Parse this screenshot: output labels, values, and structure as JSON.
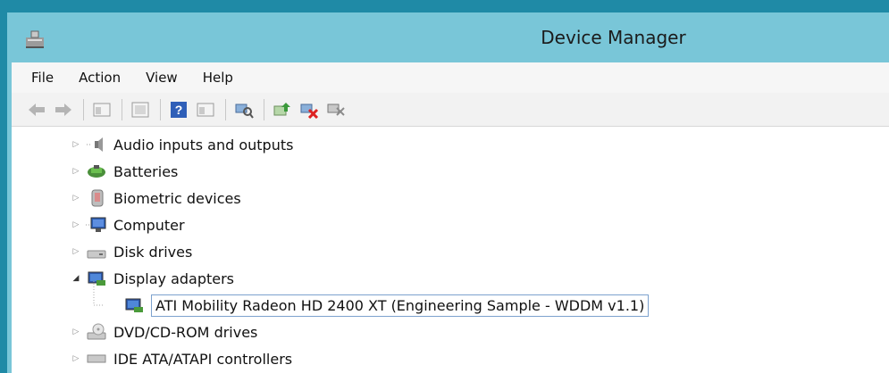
{
  "window": {
    "title": "Device Manager"
  },
  "menu": {
    "items": [
      "File",
      "Action",
      "View",
      "Help"
    ]
  },
  "toolbar": {
    "icons": [
      "back-icon",
      "forward-icon",
      "properties-view-icon",
      "hidden-devices-icon",
      "help-icon",
      "update-driver-view-icon",
      "scan-hardware-icon",
      "update-driver-icon",
      "uninstall-device-icon",
      "enable-device-icon"
    ]
  },
  "tree": {
    "items": [
      {
        "label": "Audio inputs and outputs",
        "icon": "speaker-icon",
        "expanded": false
      },
      {
        "label": "Batteries",
        "icon": "battery-icon",
        "expanded": false
      },
      {
        "label": "Biometric devices",
        "icon": "fingerprint-icon",
        "expanded": false
      },
      {
        "label": "Computer",
        "icon": "computer-icon",
        "expanded": false
      },
      {
        "label": "Disk drives",
        "icon": "disk-drive-icon",
        "expanded": false
      },
      {
        "label": "Display adapters",
        "icon": "display-adapter-icon",
        "expanded": true
      },
      {
        "label": "ATI Mobility Radeon HD 2400 XT (Engineering Sample - WDDM v1.1)",
        "icon": "display-adapter-icon",
        "child": true,
        "selected": true
      },
      {
        "label": "DVD/CD-ROM drives",
        "icon": "optical-drive-icon",
        "expanded": false
      },
      {
        "label": "IDE ATA/ATAPI controllers",
        "icon": "ide-controller-icon",
        "expanded": false
      }
    ]
  },
  "colors": {
    "titlebar": "#79c6d8",
    "desktop": "#1f8aa6",
    "selection_border": "#7da2ce"
  }
}
